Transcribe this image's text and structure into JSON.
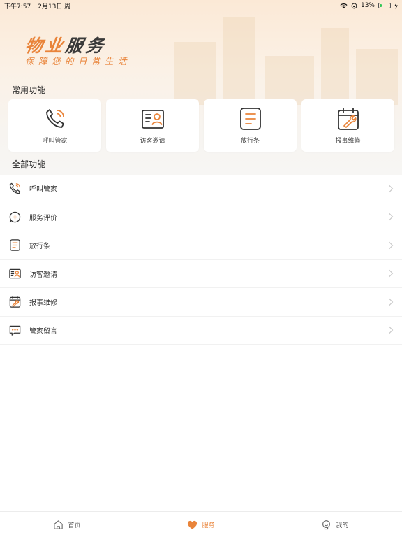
{
  "status_bar": {
    "time": "下午7:57",
    "date": "2月13日 周一",
    "battery": "13%"
  },
  "banner": {
    "title_orange": "物业",
    "title_dark": "服务",
    "subtitle": "保障您的日常生活"
  },
  "sections": {
    "common": "常用功能",
    "all": "全部功能"
  },
  "quick_actions": [
    {
      "label": "呼叫管家",
      "icon": "phone-ringing-icon"
    },
    {
      "label": "访客邀请",
      "icon": "visitor-card-icon"
    },
    {
      "label": "放行条",
      "icon": "document-list-icon"
    },
    {
      "label": "报事维修",
      "icon": "calendar-wrench-icon"
    }
  ],
  "all_functions": [
    {
      "label": "呼叫管家",
      "icon": "phone-ringing-icon"
    },
    {
      "label": "服务评价",
      "icon": "chat-plus-icon"
    },
    {
      "label": "放行条",
      "icon": "document-list-icon"
    },
    {
      "label": "访客邀请",
      "icon": "visitor-card-icon"
    },
    {
      "label": "报事维修",
      "icon": "calendar-wrench-icon"
    },
    {
      "label": "管家留言",
      "icon": "message-dots-icon"
    }
  ],
  "tabs": [
    {
      "label": "首页",
      "icon": "home-icon"
    },
    {
      "label": "服务",
      "icon": "heart-icon",
      "active": true
    },
    {
      "label": "我的",
      "icon": "user-bulb-icon"
    }
  ],
  "colors": {
    "accent": "#e9843a",
    "icon_dark": "#333333"
  }
}
